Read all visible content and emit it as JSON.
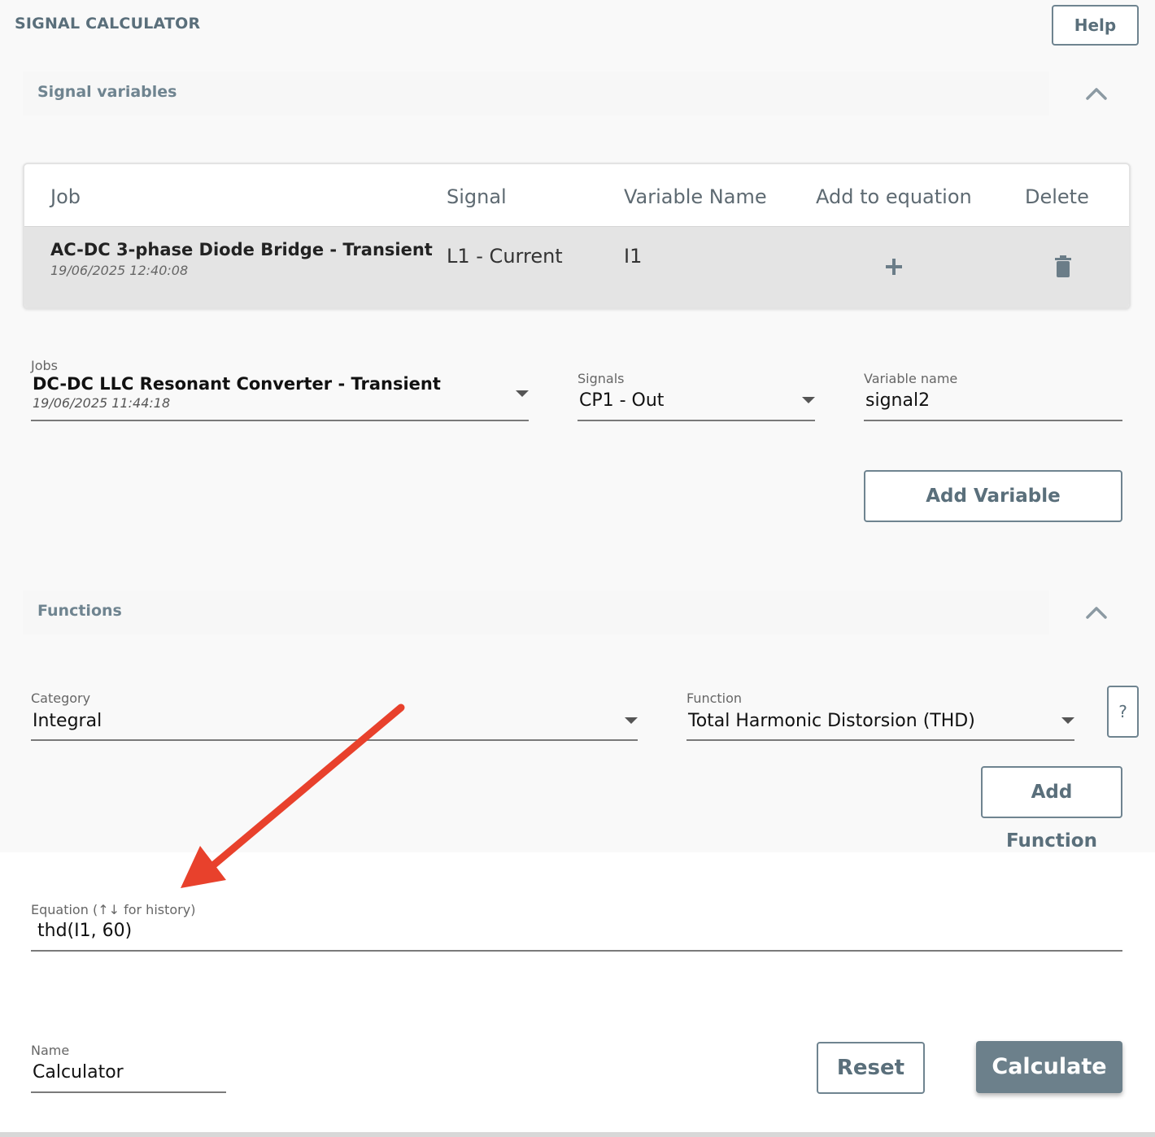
{
  "header": {
    "title": "SIGNAL CALCULATOR",
    "help_label": "Help"
  },
  "signal_variables": {
    "title": "Signal variables",
    "table": {
      "columns": [
        "Job",
        "Signal",
        "Variable Name",
        "Add to equation",
        "Delete"
      ],
      "rows": [
        {
          "job": "AC-DC 3-phase Diode Bridge - Transient",
          "timestamp": "19/06/2025 12:40:08",
          "signal": "L1 - Current",
          "variable": "I1"
        }
      ]
    },
    "form": {
      "jobs_label": "Jobs",
      "jobs_value": "DC-DC LLC Resonant Converter - Transient",
      "jobs_timestamp": "19/06/2025 11:44:18",
      "signals_label": "Signals",
      "signals_value": "CP1 - Out",
      "varname_label": "Variable name",
      "varname_value": "signal2",
      "add_variable_label": "Add Variable"
    }
  },
  "functions": {
    "title": "Functions",
    "category_label": "Category",
    "category_value": "Integral",
    "function_label": "Function",
    "function_value": "Total Harmonic Distorsion (THD)",
    "help_q": "?",
    "add_function_label": "Add Function"
  },
  "equation": {
    "label": "Equation (↑↓ for history)",
    "value": "thd(I1, 60)"
  },
  "name": {
    "label": "Name",
    "value": "Calculator"
  },
  "actions": {
    "reset_label": "Reset",
    "calculate_label": "Calculate"
  },
  "colors": {
    "accent": "#6c808b",
    "annotation_arrow": "#e8412c"
  },
  "icons": {
    "collapse": "chevron-up-icon",
    "add": "plus-icon",
    "delete": "trash-icon",
    "dropdown": "caret-down-icon"
  }
}
